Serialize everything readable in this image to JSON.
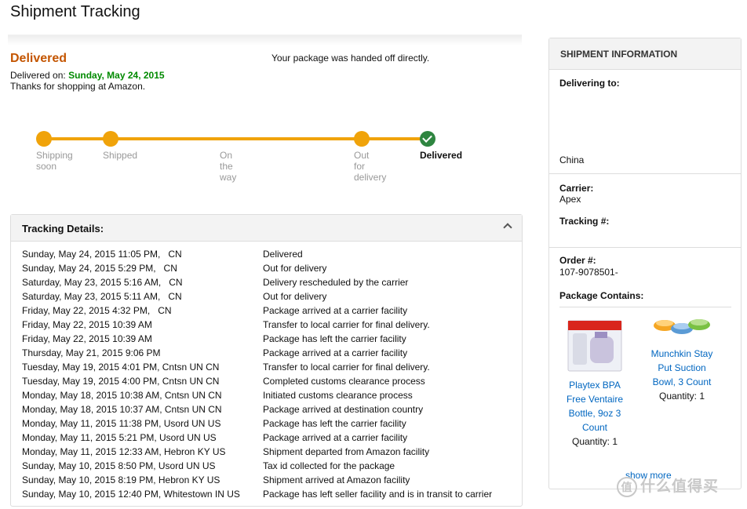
{
  "page": {
    "title": "Shipment Tracking"
  },
  "status": {
    "headline": "Delivered",
    "delivered_on_label": "Delivered on:",
    "delivered_on_date": "Sunday, May 24, 2015",
    "thanks": "Thanks for shopping at Amazon.",
    "handoff_note": "Your package was handed off directly."
  },
  "progress": {
    "steps": [
      {
        "label": "Shipping soon",
        "state": "complete"
      },
      {
        "label": "Shipped",
        "state": "complete"
      },
      {
        "label": "On the way",
        "state": "complete"
      },
      {
        "label": "Out for delivery",
        "state": "complete"
      },
      {
        "label": "Delivered",
        "state": "current"
      }
    ],
    "accent_color": "#f0a30a",
    "done_color": "#2e8540",
    "l0a": "Shipping",
    "l0b": "soon",
    "l1": "Shipped",
    "l2a": "On",
    "l2b": "the",
    "l2c": "way",
    "l3a": "Out",
    "l3b": "for",
    "l3c": "delivery",
    "l4": "Delivered"
  },
  "tracking": {
    "header": "Tracking Details:",
    "events": [
      {
        "when": "Sunday, May 24, 2015 11:05 PM,   CN",
        "what": "Delivered"
      },
      {
        "when": "Sunday, May 24, 2015 5:29 PM,   CN",
        "what": "Out for delivery"
      },
      {
        "when": "Saturday, May 23, 2015 5:16 AM,   CN",
        "what": "Delivery rescheduled by the carrier"
      },
      {
        "when": "Saturday, May 23, 2015 5:11 AM,   CN",
        "what": "Out for delivery"
      },
      {
        "when": "Friday, May 22, 2015 4:32 PM,   CN",
        "what": "Package arrived at a carrier facility"
      },
      {
        "when": "Friday, May 22, 2015 10:39 AM",
        "what": "Transfer to local carrier for final delivery."
      },
      {
        "when": "Friday, May 22, 2015 10:39 AM",
        "what": "Package has left the carrier facility"
      },
      {
        "when": "Thursday, May 21, 2015 9:06 PM",
        "what": "Package arrived at a carrier facility"
      },
      {
        "when": "Tuesday, May 19, 2015 4:01 PM, Cntsn UN CN",
        "what": "Transfer to local carrier for final delivery."
      },
      {
        "when": "Tuesday, May 19, 2015 4:00 PM, Cntsn UN CN",
        "what": "Completed customs clearance process"
      },
      {
        "when": "Monday, May 18, 2015 10:38 AM, Cntsn UN CN",
        "what": "Initiated customs clearance process"
      },
      {
        "when": "Monday, May 18, 2015 10:37 AM, Cntsn UN CN",
        "what": "Package arrived at destination country"
      },
      {
        "when": "Monday, May 11, 2015 11:38 PM, Usord UN US",
        "what": "Package has left the carrier facility"
      },
      {
        "when": "Monday, May 11, 2015 5:21 PM, Usord UN US",
        "what": "Package arrived at a carrier facility"
      },
      {
        "when": "Monday, May 11, 2015 12:33 AM, Hebron KY US",
        "what": "Shipment departed from Amazon facility"
      },
      {
        "when": "Sunday, May 10, 2015 8:50 PM, Usord UN US",
        "what": "Tax id collected for the package"
      },
      {
        "when": "Sunday, May 10, 2015 8:19 PM, Hebron KY US",
        "what": "Shipment arrived at Amazon facility"
      },
      {
        "when": "Sunday, May 10, 2015 12:40 PM, Whitestown IN US",
        "what": "Package has left seller facility and is in transit to carrier"
      }
    ]
  },
  "shipment_info": {
    "header": "SHIPMENT INFORMATION",
    "delivering_to_label": "Delivering to:",
    "country": "China",
    "carrier_label": "Carrier:",
    "carrier": "Apex",
    "tracking_label": "Tracking #:",
    "order_label": "Order #:",
    "order_number": "107-9078501-",
    "contains_label": "Package Contains:",
    "items": [
      {
        "name_lines": [
          "Playtex BPA",
          "Free Ventaire",
          "Bottle, 9oz 3",
          "Count"
        ],
        "quantity": "Quantity: 1",
        "icon": "baby-bottle-box-image"
      },
      {
        "name_lines": [
          "Munchkin Stay",
          "Put Suction",
          "Bowl, 3 Count"
        ],
        "quantity": "Quantity: 1",
        "icon": "suction-bowls-image"
      }
    ],
    "show_more": "show more"
  },
  "watermark": {
    "text": "什么值得买",
    "mark": "值"
  }
}
